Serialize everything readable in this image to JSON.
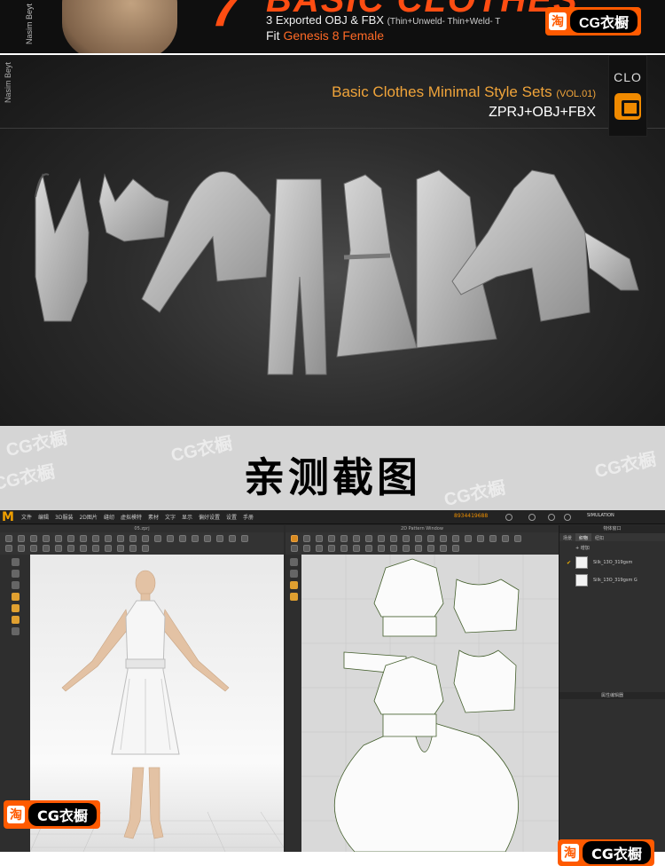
{
  "banner": {
    "author": "Nasim Beyt",
    "number": "7",
    "headline": "BASIC CLOTHES",
    "export_line": "3 Exported OBJ & FBX",
    "export_detail": "(Thin+Unweld- Thin+Weld- T",
    "fit_label": "Fit",
    "fit_value": "Genesis 8 Female"
  },
  "watermark": {
    "tao": "淘",
    "brand": "CG衣橱"
  },
  "product": {
    "author": "Nasim Beyt",
    "title": "Basic Clothes Minimal Style Sets",
    "volume": "(VOL.01)",
    "formats": "ZPRJ+OBJ+FBX",
    "clo_logo": "CLO"
  },
  "mid": {
    "heading": "亲测截图"
  },
  "app": {
    "logo": "M",
    "menus": [
      "文件",
      "编辑",
      "3D服装",
      "2D图片",
      "缝纫",
      "虚拟模特",
      "素材",
      "文字",
      "显示",
      "偏好设置",
      "设置",
      "手册"
    ],
    "points": "8934419688",
    "mode": "SIMULATION",
    "view3d_title": "05.zprj",
    "view2d_title": "2D Pattern Window",
    "right_header": "物体窗口",
    "right_tabs": [
      "场景",
      "织物",
      "纽扣"
    ],
    "right_tab_active": 1,
    "add_label": "+ 增加",
    "fabrics": [
      {
        "name": "Silk_13O_319gsm",
        "checked": true
      },
      {
        "name": "Silk_13O_319gsm G",
        "checked": false
      }
    ],
    "property_editor": "属性编辑器"
  },
  "colors": {
    "accent": "#ff5a00",
    "clo_orange": "#f08a00",
    "title_gold": "#f0a43a"
  }
}
